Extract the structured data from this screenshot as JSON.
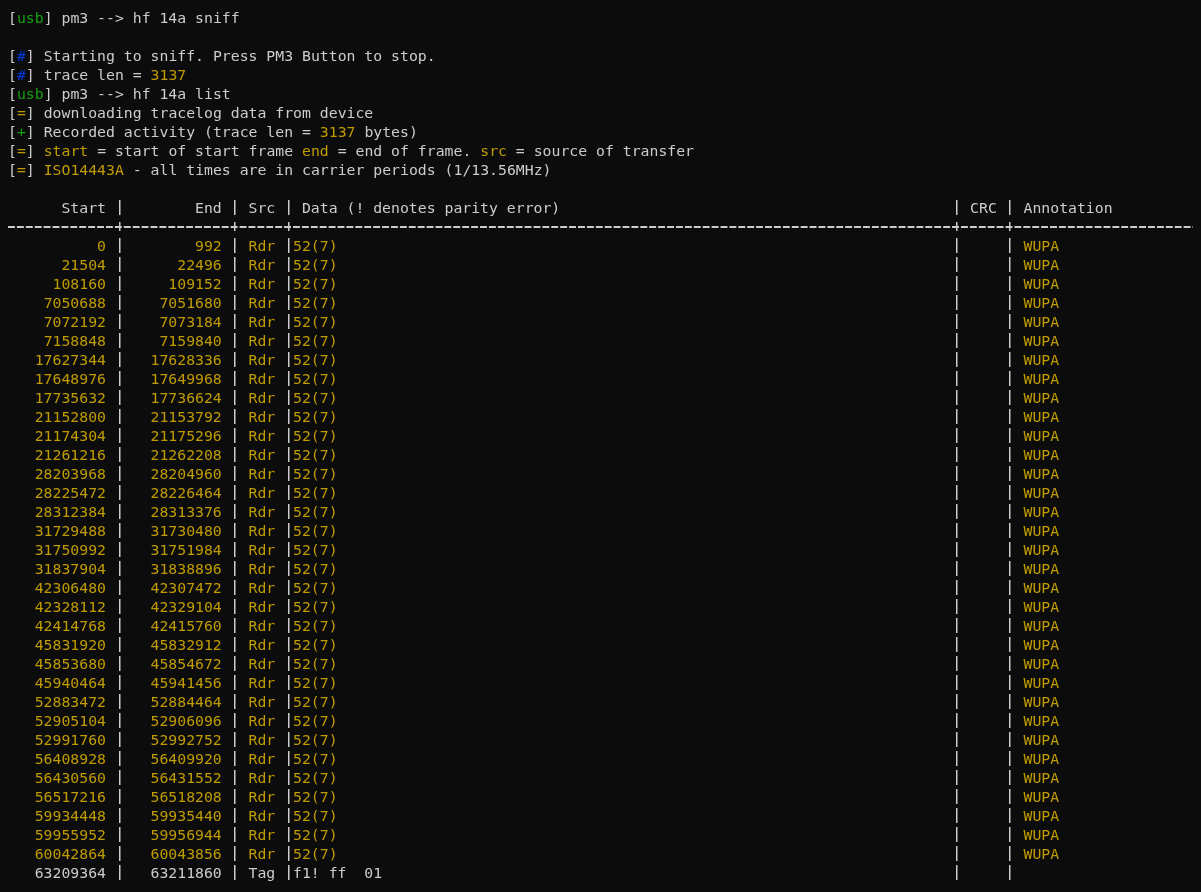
{
  "terminal": {
    "lines": [
      {
        "kind": "command",
        "parts": [
          {
            "text": "[",
            "color": "#cccccc"
          },
          {
            "text": "usb",
            "color": "#13a10e"
          },
          {
            "text": "] pm3 --> hf 14a sniff",
            "color": "#cccccc"
          }
        ]
      },
      {
        "kind": "blank"
      },
      {
        "kind": "log",
        "parts": [
          {
            "text": "[",
            "color": "#cccccc"
          },
          {
            "text": "#",
            "color": "#0037da"
          },
          {
            "text": "] Starting to sniff. Press PM3 Button to stop.",
            "color": "#cccccc"
          }
        ]
      },
      {
        "kind": "log",
        "parts": [
          {
            "text": "[",
            "color": "#cccccc"
          },
          {
            "text": "#",
            "color": "#0037da"
          },
          {
            "text": "] trace len = ",
            "color": "#cccccc"
          },
          {
            "text": "3137",
            "color": "#c19c00"
          }
        ]
      },
      {
        "kind": "command",
        "parts": [
          {
            "text": "[",
            "color": "#cccccc"
          },
          {
            "text": "usb",
            "color": "#13a10e"
          },
          {
            "text": "] pm3 --> hf 14a list",
            "color": "#cccccc"
          }
        ]
      },
      {
        "kind": "log",
        "parts": [
          {
            "text": "[",
            "color": "#cccccc"
          },
          {
            "text": "=",
            "color": "#c19c00"
          },
          {
            "text": "] downloading tracelog data from device",
            "color": "#cccccc"
          }
        ]
      },
      {
        "kind": "log",
        "parts": [
          {
            "text": "[",
            "color": "#cccccc"
          },
          {
            "text": "+",
            "color": "#13a10e"
          },
          {
            "text": "] Recorded activity (trace len = ",
            "color": "#cccccc"
          },
          {
            "text": "3137",
            "color": "#c19c00"
          },
          {
            "text": " bytes)",
            "color": "#cccccc"
          }
        ]
      },
      {
        "kind": "log",
        "parts": [
          {
            "text": "[",
            "color": "#cccccc"
          },
          {
            "text": "=",
            "color": "#c19c00"
          },
          {
            "text": "] ",
            "color": "#cccccc"
          },
          {
            "text": "start",
            "color": "#c19c00"
          },
          {
            "text": " = start of start frame ",
            "color": "#cccccc"
          },
          {
            "text": "end",
            "color": "#c19c00"
          },
          {
            "text": " = end of frame. ",
            "color": "#cccccc"
          },
          {
            "text": "src",
            "color": "#c19c00"
          },
          {
            "text": " = source of transfer",
            "color": "#cccccc"
          }
        ]
      },
      {
        "kind": "log",
        "parts": [
          {
            "text": "[",
            "color": "#cccccc"
          },
          {
            "text": "=",
            "color": "#c19c00"
          },
          {
            "text": "] ",
            "color": "#cccccc"
          },
          {
            "text": "ISO14443A",
            "color": "#c19c00"
          },
          {
            "text": " - all times are in carrier periods (1/13.56MHz)",
            "color": "#cccccc"
          }
        ]
      },
      {
        "kind": "blank"
      }
    ]
  },
  "table": {
    "columns": [
      "Start",
      "End",
      "Src",
      "Data (! denotes parity error)",
      "CRC",
      "Annotation"
    ],
    "rows": [
      {
        "start": "0",
        "end": "992",
        "src": "Rdr",
        "data": "52(7)",
        "annotation": "WUPA",
        "color": "#c19c00"
      },
      {
        "start": "21504",
        "end": "22496",
        "src": "Rdr",
        "data": "52(7)",
        "annotation": "WUPA",
        "color": "#c19c00"
      },
      {
        "start": "108160",
        "end": "109152",
        "src": "Rdr",
        "data": "52(7)",
        "annotation": "WUPA",
        "color": "#c19c00"
      },
      {
        "start": "7050688",
        "end": "7051680",
        "src": "Rdr",
        "data": "52(7)",
        "annotation": "WUPA",
        "color": "#c19c00"
      },
      {
        "start": "7072192",
        "end": "7073184",
        "src": "Rdr",
        "data": "52(7)",
        "annotation": "WUPA",
        "color": "#c19c00"
      },
      {
        "start": "7158848",
        "end": "7159840",
        "src": "Rdr",
        "data": "52(7)",
        "annotation": "WUPA",
        "color": "#c19c00"
      },
      {
        "start": "17627344",
        "end": "17628336",
        "src": "Rdr",
        "data": "52(7)",
        "annotation": "WUPA",
        "color": "#c19c00"
      },
      {
        "start": "17648976",
        "end": "17649968",
        "src": "Rdr",
        "data": "52(7)",
        "annotation": "WUPA",
        "color": "#c19c00"
      },
      {
        "start": "17735632",
        "end": "17736624",
        "src": "Rdr",
        "data": "52(7)",
        "annotation": "WUPA",
        "color": "#c19c00"
      },
      {
        "start": "21152800",
        "end": "21153792",
        "src": "Rdr",
        "data": "52(7)",
        "annotation": "WUPA",
        "color": "#c19c00"
      },
      {
        "start": "21174304",
        "end": "21175296",
        "src": "Rdr",
        "data": "52(7)",
        "annotation": "WUPA",
        "color": "#c19c00"
      },
      {
        "start": "21261216",
        "end": "21262208",
        "src": "Rdr",
        "data": "52(7)",
        "annotation": "WUPA",
        "color": "#c19c00"
      },
      {
        "start": "28203968",
        "end": "28204960",
        "src": "Rdr",
        "data": "52(7)",
        "annotation": "WUPA",
        "color": "#c19c00"
      },
      {
        "start": "28225472",
        "end": "28226464",
        "src": "Rdr",
        "data": "52(7)",
        "annotation": "WUPA",
        "color": "#c19c00"
      },
      {
        "start": "28312384",
        "end": "28313376",
        "src": "Rdr",
        "data": "52(7)",
        "annotation": "WUPA",
        "color": "#c19c00"
      },
      {
        "start": "31729488",
        "end": "31730480",
        "src": "Rdr",
        "data": "52(7)",
        "annotation": "WUPA",
        "color": "#c19c00"
      },
      {
        "start": "31750992",
        "end": "31751984",
        "src": "Rdr",
        "data": "52(7)",
        "annotation": "WUPA",
        "color": "#c19c00"
      },
      {
        "start": "31837904",
        "end": "31838896",
        "src": "Rdr",
        "data": "52(7)",
        "annotation": "WUPA",
        "color": "#c19c00"
      },
      {
        "start": "42306480",
        "end": "42307472",
        "src": "Rdr",
        "data": "52(7)",
        "annotation": "WUPA",
        "color": "#c19c00"
      },
      {
        "start": "42328112",
        "end": "42329104",
        "src": "Rdr",
        "data": "52(7)",
        "annotation": "WUPA",
        "color": "#c19c00"
      },
      {
        "start": "42414768",
        "end": "42415760",
        "src": "Rdr",
        "data": "52(7)",
        "annotation": "WUPA",
        "color": "#c19c00"
      },
      {
        "start": "45831920",
        "end": "45832912",
        "src": "Rdr",
        "data": "52(7)",
        "annotation": "WUPA",
        "color": "#c19c00"
      },
      {
        "start": "45853680",
        "end": "45854672",
        "src": "Rdr",
        "data": "52(7)",
        "annotation": "WUPA",
        "color": "#c19c00"
      },
      {
        "start": "45940464",
        "end": "45941456",
        "src": "Rdr",
        "data": "52(7)",
        "annotation": "WUPA",
        "color": "#c19c00"
      },
      {
        "start": "52883472",
        "end": "52884464",
        "src": "Rdr",
        "data": "52(7)",
        "annotation": "WUPA",
        "color": "#c19c00"
      },
      {
        "start": "52905104",
        "end": "52906096",
        "src": "Rdr",
        "data": "52(7)",
        "annotation": "WUPA",
        "color": "#c19c00"
      },
      {
        "start": "52991760",
        "end": "52992752",
        "src": "Rdr",
        "data": "52(7)",
        "annotation": "WUPA",
        "color": "#c19c00"
      },
      {
        "start": "56408928",
        "end": "56409920",
        "src": "Rdr",
        "data": "52(7)",
        "annotation": "WUPA",
        "color": "#c19c00"
      },
      {
        "start": "56430560",
        "end": "56431552",
        "src": "Rdr",
        "data": "52(7)",
        "annotation": "WUPA",
        "color": "#c19c00"
      },
      {
        "start": "56517216",
        "end": "56518208",
        "src": "Rdr",
        "data": "52(7)",
        "annotation": "WUPA",
        "color": "#c19c00"
      },
      {
        "start": "59934448",
        "end": "59935440",
        "src": "Rdr",
        "data": "52(7)",
        "annotation": "WUPA",
        "color": "#c19c00"
      },
      {
        "start": "59955952",
        "end": "59956944",
        "src": "Rdr",
        "data": "52(7)",
        "annotation": "WUPA",
        "color": "#c19c00"
      },
      {
        "start": "60042864",
        "end": "60043856",
        "src": "Rdr",
        "data": "52(7)",
        "annotation": "WUPA",
        "color": "#c19c00"
      },
      {
        "start": "63209364",
        "end": "63211860",
        "src": "Tag",
        "data": "f1! ff  01",
        "color": "#cccccc"
      }
    ]
  }
}
